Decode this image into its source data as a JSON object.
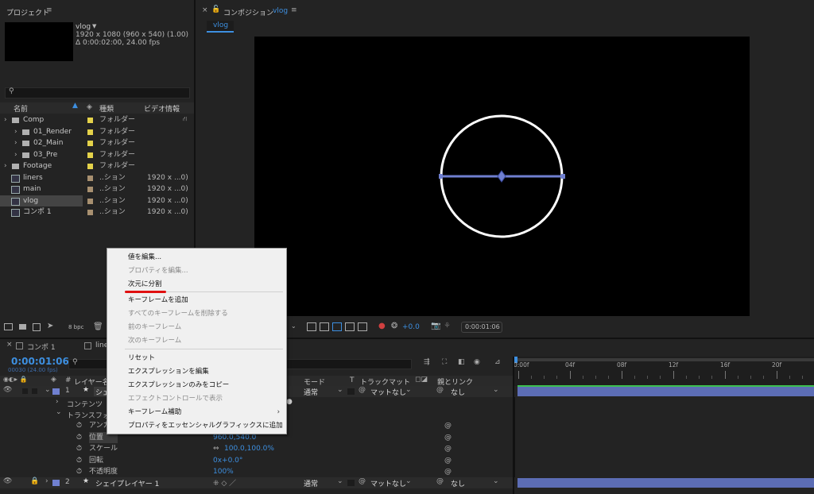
{
  "project": {
    "title": "プロジェクト",
    "item_name": "vlog",
    "item_info1": "1920 x 1080  (960 x 540) (1.00)",
    "item_info2": "Δ 0:00:02:00, 24.00 fps",
    "search_placeholder": "",
    "columns": {
      "name": "名前",
      "type": "種類",
      "video": "ビデオ情報"
    },
    "rows": [
      {
        "name": "Comp",
        "type": "フォルダー",
        "info": "",
        "level": 0,
        "kind": "folder",
        "color": "#e4d24a",
        "selected": false
      },
      {
        "name": "01_Render",
        "type": "フォルダー",
        "info": "",
        "level": 1,
        "kind": "folder",
        "color": "#e4d24a",
        "selected": false
      },
      {
        "name": "02_Main",
        "type": "フォルダー",
        "info": "",
        "level": 1,
        "kind": "folder",
        "color": "#e4d24a",
        "selected": false
      },
      {
        "name": "03_Pre",
        "type": "フォルダー",
        "info": "",
        "level": 1,
        "kind": "folder",
        "color": "#e4d24a",
        "selected": false
      },
      {
        "name": "Footage",
        "type": "フォルダー",
        "info": "",
        "level": 0,
        "kind": "folder",
        "color": "#e4d24a",
        "selected": false
      },
      {
        "name": "liners",
        "type": "..ション",
        "info": "1920 x ...0)",
        "level": 0,
        "kind": "comp",
        "color": "#a89070",
        "selected": false
      },
      {
        "name": "main",
        "type": "..ション",
        "info": "1920 x ...0)",
        "level": 0,
        "kind": "comp",
        "color": "#a89070",
        "selected": false
      },
      {
        "name": "vlog",
        "type": "..ション",
        "info": "1920 x ...0)",
        "level": 0,
        "kind": "comp",
        "color": "#a89070",
        "selected": true
      },
      {
        "name": "コンポ 1",
        "type": "..ション",
        "info": "1920 x ...0)",
        "level": 0,
        "kind": "comp",
        "color": "#a89070",
        "selected": false
      }
    ],
    "bpc": "8 bpc"
  },
  "composition": {
    "panel_title": "コンポジション",
    "comp_name": "vlog",
    "tab": "vlog",
    "timecode": "0:00:01:06",
    "exposure": "+0.0"
  },
  "timeline": {
    "tabs": [
      "コンポ 1",
      "liners"
    ],
    "current_time": "0:00:01:06",
    "fps_line": "00030 (24.00 fps)",
    "col_headers": {
      "layer_name": "レイヤー名",
      "mode": "モード",
      "track_matte": "トラックマット",
      "parent": "親とリンク"
    },
    "ruler": [
      "0:00f",
      "04f",
      "08f",
      "12f",
      "16f",
      "20f"
    ],
    "layer1": {
      "num": "1",
      "name": "シェイプレイヤー 2",
      "mode": "通常",
      "matte": "マットなし",
      "parent": "なし"
    },
    "layer2": {
      "num": "2",
      "name": "シェイプレイヤー 1",
      "mode": "通常",
      "matte": "マットなし",
      "parent": "なし"
    },
    "contents": "コンテンツ",
    "transform": "トランスフォーム",
    "props": [
      {
        "name": "アンカー",
        "value": ""
      },
      {
        "name": "位置",
        "value": "960.0,540.0"
      },
      {
        "name": "スケール",
        "value": "100.0,100.0%"
      },
      {
        "name": "回転",
        "value": "0x+0.0°"
      },
      {
        "name": "不透明度",
        "value": "100%"
      }
    ]
  },
  "context_menu": {
    "items": [
      {
        "label": "値を編集...",
        "disabled": false
      },
      {
        "label": "プロパティを編集...",
        "disabled": true
      },
      {
        "label": "次元に分割",
        "disabled": false
      },
      {
        "label": "キーフレームを追加",
        "disabled": false
      },
      {
        "label": "すべてのキーフレームを削除する",
        "disabled": true
      },
      {
        "label": "前のキーフレーム",
        "disabled": true
      },
      {
        "label": "次のキーフレーム",
        "disabled": true
      },
      {
        "label": "リセット",
        "disabled": false
      },
      {
        "label": "エクスプレッションを編集",
        "disabled": false
      },
      {
        "label": "エクスプレッションのみをコピー",
        "disabled": false
      },
      {
        "label": "エフェクトコントロールで表示",
        "disabled": true
      },
      {
        "label": "キーフレーム補助",
        "disabled": false,
        "submenu": true
      },
      {
        "label": "プロパティをエッセンシャルグラフィックスに追加",
        "disabled": false
      }
    ]
  },
  "colors": {
    "accent": "#3d8fe0",
    "layer_bar": "#5c6db5",
    "label_blue": "#7080d0",
    "annotation": "#e01010"
  }
}
